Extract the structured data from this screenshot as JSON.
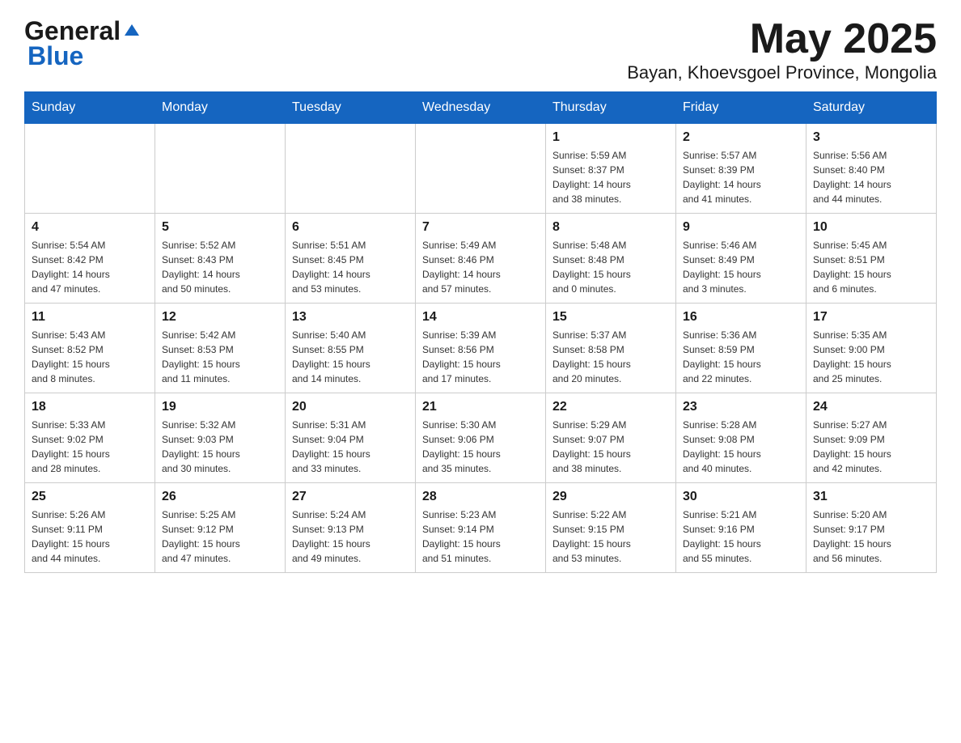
{
  "logo": {
    "general": "General",
    "triangle": "▲",
    "blue": "Blue"
  },
  "header": {
    "month_title": "May 2025",
    "location": "Bayan, Khoevsgoel Province, Mongolia"
  },
  "weekdays": [
    "Sunday",
    "Monday",
    "Tuesday",
    "Wednesday",
    "Thursday",
    "Friday",
    "Saturday"
  ],
  "weeks": [
    [
      {
        "day": "",
        "info": ""
      },
      {
        "day": "",
        "info": ""
      },
      {
        "day": "",
        "info": ""
      },
      {
        "day": "",
        "info": ""
      },
      {
        "day": "1",
        "info": "Sunrise: 5:59 AM\nSunset: 8:37 PM\nDaylight: 14 hours\nand 38 minutes."
      },
      {
        "day": "2",
        "info": "Sunrise: 5:57 AM\nSunset: 8:39 PM\nDaylight: 14 hours\nand 41 minutes."
      },
      {
        "day": "3",
        "info": "Sunrise: 5:56 AM\nSunset: 8:40 PM\nDaylight: 14 hours\nand 44 minutes."
      }
    ],
    [
      {
        "day": "4",
        "info": "Sunrise: 5:54 AM\nSunset: 8:42 PM\nDaylight: 14 hours\nand 47 minutes."
      },
      {
        "day": "5",
        "info": "Sunrise: 5:52 AM\nSunset: 8:43 PM\nDaylight: 14 hours\nand 50 minutes."
      },
      {
        "day": "6",
        "info": "Sunrise: 5:51 AM\nSunset: 8:45 PM\nDaylight: 14 hours\nand 53 minutes."
      },
      {
        "day": "7",
        "info": "Sunrise: 5:49 AM\nSunset: 8:46 PM\nDaylight: 14 hours\nand 57 minutes."
      },
      {
        "day": "8",
        "info": "Sunrise: 5:48 AM\nSunset: 8:48 PM\nDaylight: 15 hours\nand 0 minutes."
      },
      {
        "day": "9",
        "info": "Sunrise: 5:46 AM\nSunset: 8:49 PM\nDaylight: 15 hours\nand 3 minutes."
      },
      {
        "day": "10",
        "info": "Sunrise: 5:45 AM\nSunset: 8:51 PM\nDaylight: 15 hours\nand 6 minutes."
      }
    ],
    [
      {
        "day": "11",
        "info": "Sunrise: 5:43 AM\nSunset: 8:52 PM\nDaylight: 15 hours\nand 8 minutes."
      },
      {
        "day": "12",
        "info": "Sunrise: 5:42 AM\nSunset: 8:53 PM\nDaylight: 15 hours\nand 11 minutes."
      },
      {
        "day": "13",
        "info": "Sunrise: 5:40 AM\nSunset: 8:55 PM\nDaylight: 15 hours\nand 14 minutes."
      },
      {
        "day": "14",
        "info": "Sunrise: 5:39 AM\nSunset: 8:56 PM\nDaylight: 15 hours\nand 17 minutes."
      },
      {
        "day": "15",
        "info": "Sunrise: 5:37 AM\nSunset: 8:58 PM\nDaylight: 15 hours\nand 20 minutes."
      },
      {
        "day": "16",
        "info": "Sunrise: 5:36 AM\nSunset: 8:59 PM\nDaylight: 15 hours\nand 22 minutes."
      },
      {
        "day": "17",
        "info": "Sunrise: 5:35 AM\nSunset: 9:00 PM\nDaylight: 15 hours\nand 25 minutes."
      }
    ],
    [
      {
        "day": "18",
        "info": "Sunrise: 5:33 AM\nSunset: 9:02 PM\nDaylight: 15 hours\nand 28 minutes."
      },
      {
        "day": "19",
        "info": "Sunrise: 5:32 AM\nSunset: 9:03 PM\nDaylight: 15 hours\nand 30 minutes."
      },
      {
        "day": "20",
        "info": "Sunrise: 5:31 AM\nSunset: 9:04 PM\nDaylight: 15 hours\nand 33 minutes."
      },
      {
        "day": "21",
        "info": "Sunrise: 5:30 AM\nSunset: 9:06 PM\nDaylight: 15 hours\nand 35 minutes."
      },
      {
        "day": "22",
        "info": "Sunrise: 5:29 AM\nSunset: 9:07 PM\nDaylight: 15 hours\nand 38 minutes."
      },
      {
        "day": "23",
        "info": "Sunrise: 5:28 AM\nSunset: 9:08 PM\nDaylight: 15 hours\nand 40 minutes."
      },
      {
        "day": "24",
        "info": "Sunrise: 5:27 AM\nSunset: 9:09 PM\nDaylight: 15 hours\nand 42 minutes."
      }
    ],
    [
      {
        "day": "25",
        "info": "Sunrise: 5:26 AM\nSunset: 9:11 PM\nDaylight: 15 hours\nand 44 minutes."
      },
      {
        "day": "26",
        "info": "Sunrise: 5:25 AM\nSunset: 9:12 PM\nDaylight: 15 hours\nand 47 minutes."
      },
      {
        "day": "27",
        "info": "Sunrise: 5:24 AM\nSunset: 9:13 PM\nDaylight: 15 hours\nand 49 minutes."
      },
      {
        "day": "28",
        "info": "Sunrise: 5:23 AM\nSunset: 9:14 PM\nDaylight: 15 hours\nand 51 minutes."
      },
      {
        "day": "29",
        "info": "Sunrise: 5:22 AM\nSunset: 9:15 PM\nDaylight: 15 hours\nand 53 minutes."
      },
      {
        "day": "30",
        "info": "Sunrise: 5:21 AM\nSunset: 9:16 PM\nDaylight: 15 hours\nand 55 minutes."
      },
      {
        "day": "31",
        "info": "Sunrise: 5:20 AM\nSunset: 9:17 PM\nDaylight: 15 hours\nand 56 minutes."
      }
    ]
  ]
}
